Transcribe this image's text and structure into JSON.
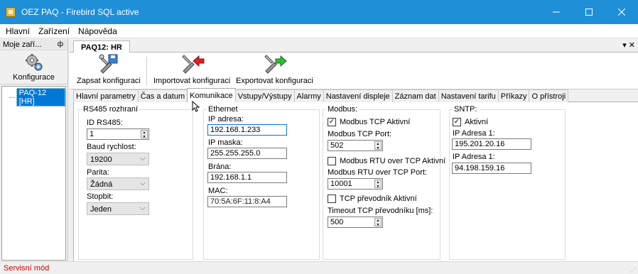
{
  "window": {
    "title": "OEZ PAQ - Firebird SQL active"
  },
  "menu": {
    "items": [
      "Hlavní",
      "Zařízení",
      "Nápověda"
    ]
  },
  "left_panel": {
    "header": "Moje zaří...",
    "pin_icon": "ф",
    "button_label": "Konfigurace",
    "tree_item": "PAQ-12 [HR]"
  },
  "document": {
    "tab": "PAQ12: HR"
  },
  "toolbar": {
    "write_label": "Zapsat konfiguraci",
    "import_label": "Importovat konfiguraci",
    "export_label": "Exportovat konfiguraci"
  },
  "tabs": [
    {
      "label": "Hlavní parametry",
      "active": false
    },
    {
      "label": "Čas a datum",
      "active": false
    },
    {
      "label": "Komunikace",
      "active": true
    },
    {
      "label": "Vstupy/Výstupy",
      "active": false
    },
    {
      "label": "Alarmy",
      "active": false
    },
    {
      "label": "Nastavení displeje",
      "active": false
    },
    {
      "label": "Záznam dat",
      "active": false
    },
    {
      "label": "Nastavení tarifu",
      "active": false
    },
    {
      "label": "Příkazy",
      "active": false
    },
    {
      "label": "O přístroji",
      "active": false
    }
  ],
  "rs485": {
    "legend": "RS485 rozhraní",
    "id_label": "ID RS485:",
    "id_value": "1",
    "baud_label": "Baud rychlost:",
    "baud_value": "19200",
    "parity_label": "Parita:",
    "parity_value": "Žádná",
    "stopbit_label": "Stopbit:",
    "stopbit_value": "Jeden"
  },
  "ethernet": {
    "legend": "Ethernet",
    "ip_label": "IP adresa:",
    "ip_value": "192.168.1.233",
    "mask_label": "IP maska:",
    "mask_value": "255.255.255.0",
    "gateway_label": "Brána:",
    "gateway_value": "192.168.1.1",
    "mac_label": "MAC:",
    "mac_value": "70:5A:6F:11:8:A4"
  },
  "modbus": {
    "legend": "Modbus:",
    "tcp_active_label": "Modbus TCP Aktivní",
    "tcp_active": true,
    "tcp_port_label": "Modbus TCP Port:",
    "tcp_port_value": "502",
    "rtu_active_label": "Modbus RTU over TCP Aktivní",
    "rtu_active": false,
    "rtu_port_label": "Modbus RTU over TCP Port:",
    "rtu_port_value": "10001",
    "conv_active_label": "TCP převodník Aktivní",
    "conv_active": false,
    "timeout_label": "Timeout TCP převodníku [ms]:",
    "timeout_value": "500"
  },
  "sntp": {
    "legend": "SNTP:",
    "active_label": "Aktivní",
    "active": true,
    "addr1_label": "IP Adresa 1:",
    "addr1_value": "195.201.20.16",
    "addr2_label": "IP Adresa 1:",
    "addr2_value": "94.198.159.16"
  },
  "status": {
    "text": "Servisní mód"
  },
  "colors": {
    "titlebar": "#1f8fd8",
    "selection": "#0078d7",
    "status_text": "#d00000",
    "import_arrow": "#e02020",
    "export_arrow": "#2ebd3a"
  }
}
